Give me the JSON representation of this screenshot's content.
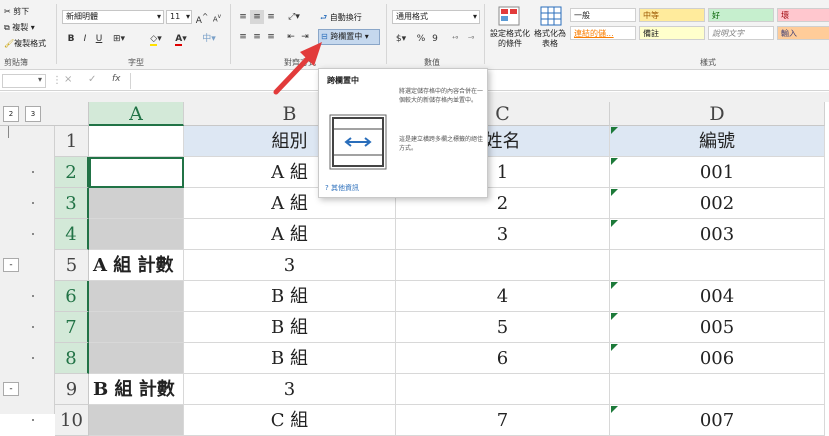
{
  "ribbon": {
    "clipboard": {
      "cut": "剪下",
      "copy": "複製",
      "format_painter": "複製格式",
      "group": "剪貼簿"
    },
    "font": {
      "name": "新細明體",
      "size": "11",
      "bold": "B",
      "italic": "I",
      "underline": "U",
      "increase": "A",
      "decrease": "A",
      "group": "字型"
    },
    "alignment": {
      "wrap_text": "自動換行",
      "merge_center": "跨欄置中",
      "group": "對齊方式"
    },
    "number": {
      "format": "通用格式",
      "currency": "$",
      "percent": "%",
      "comma": "9",
      "group": "數值"
    },
    "styles": {
      "conditional": "設定格式化的條件",
      "table": "格式化為表格",
      "group": "樣式",
      "cells": [
        {
          "label": "一般",
          "bg": "#ffffff",
          "fg": "#222222"
        },
        {
          "label": "中等",
          "bg": "#ffeb9c",
          "fg": "#9c5700"
        },
        {
          "label": "好",
          "bg": "#c6efce",
          "fg": "#006100"
        },
        {
          "label": "壞",
          "bg": "#ffc7ce",
          "fg": "#9c0006"
        },
        {
          "label": "連結的儲...",
          "bg": "#ffffff",
          "fg": "#fa7d00"
        },
        {
          "label": "備註",
          "bg": "#ffffcc",
          "fg": "#222222"
        },
        {
          "label": "說明文字",
          "bg": "#ffffff",
          "fg": "#7f7f7f"
        },
        {
          "label": "輸入",
          "bg": "#ffcc99",
          "fg": "#3f3f76"
        }
      ]
    }
  },
  "formula_bar": {
    "fx": "fx",
    "cancel": "×",
    "enter": "✓"
  },
  "outline_levels": [
    "2",
    "3"
  ],
  "columns": [
    "A",
    "B",
    "C",
    "D"
  ],
  "rows": [
    {
      "num": "1",
      "a": "",
      "b": "組別",
      "c": "姓名",
      "d": "編號",
      "outline": ""
    },
    {
      "num": "2",
      "a": "",
      "b": "A 組",
      "c": "1",
      "d": "001",
      "outline": ""
    },
    {
      "num": "3",
      "a": "",
      "b": "A 組",
      "c": "2",
      "d": "002",
      "outline": ""
    },
    {
      "num": "4",
      "a": "",
      "b": "A 組",
      "c": "3",
      "d": "003",
      "outline": ""
    },
    {
      "num": "5",
      "a": "A 組 計數",
      "b": "3",
      "c": "",
      "d": "",
      "outline": "-"
    },
    {
      "num": "6",
      "a": "",
      "b": "B 組",
      "c": "4",
      "d": "004",
      "outline": ""
    },
    {
      "num": "7",
      "a": "",
      "b": "B 組",
      "c": "5",
      "d": "005",
      "outline": ""
    },
    {
      "num": "8",
      "a": "",
      "b": "B 組",
      "c": "6",
      "d": "006",
      "outline": ""
    },
    {
      "num": "9",
      "a": "B 組 計數",
      "b": "3",
      "c": "",
      "d": "",
      "outline": "-"
    },
    {
      "num": "10",
      "a": "",
      "b": "C 組",
      "c": "7",
      "d": "007",
      "outline": ""
    }
  ],
  "tooltip": {
    "title": "跨欄置中",
    "desc1": "將選定儲存格中的內容合併在一個較大的新儲存格內並置中。",
    "desc2": "這是建立橫跨多欄之標籤的絕佳方式。",
    "more": "其他資訊"
  },
  "colors": {
    "accent": "#217346",
    "arrow": "#e23b3b",
    "header_fill": "#dde7f3"
  }
}
